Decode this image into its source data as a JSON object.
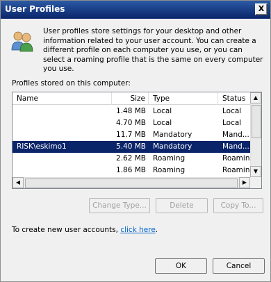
{
  "window": {
    "title": "User Profiles",
    "close_label": "X"
  },
  "description": "User profiles store settings for your desktop and other information related to your user account. You can create a different profile on each computer you use, or you can select a roaming profile that is the same on every computer you use.",
  "profiles_label": "Profiles stored on this computer:",
  "table": {
    "columns": [
      "Name",
      "Size",
      "Type",
      "Status"
    ],
    "rows": [
      {
        "name": "",
        "size": "1.48 MB",
        "type": "Local",
        "status": "Local"
      },
      {
        "name": "",
        "size": "4.70 MB",
        "type": "Local",
        "status": "Local"
      },
      {
        "name": "",
        "size": "11.7 MB",
        "type": "Mandatory",
        "status": "Mand..."
      },
      {
        "name": "RISK\\eskimo1",
        "size": "5.40 MB",
        "type": "Mandatory",
        "status": "Mand...",
        "selected": true
      },
      {
        "name": "",
        "size": "2.62 MB",
        "type": "Roaming",
        "status": "Roaming"
      },
      {
        "name": "",
        "size": "1.86 MB",
        "type": "Roaming",
        "status": "Roaming"
      }
    ]
  },
  "buttons": {
    "change_type": "Change Type...",
    "delete": "Delete",
    "copy_to": "Copy To...",
    "ok": "OK",
    "cancel": "Cancel"
  },
  "create_text": "To create new user accounts, ",
  "create_link": "click here",
  "create_suffix": "."
}
